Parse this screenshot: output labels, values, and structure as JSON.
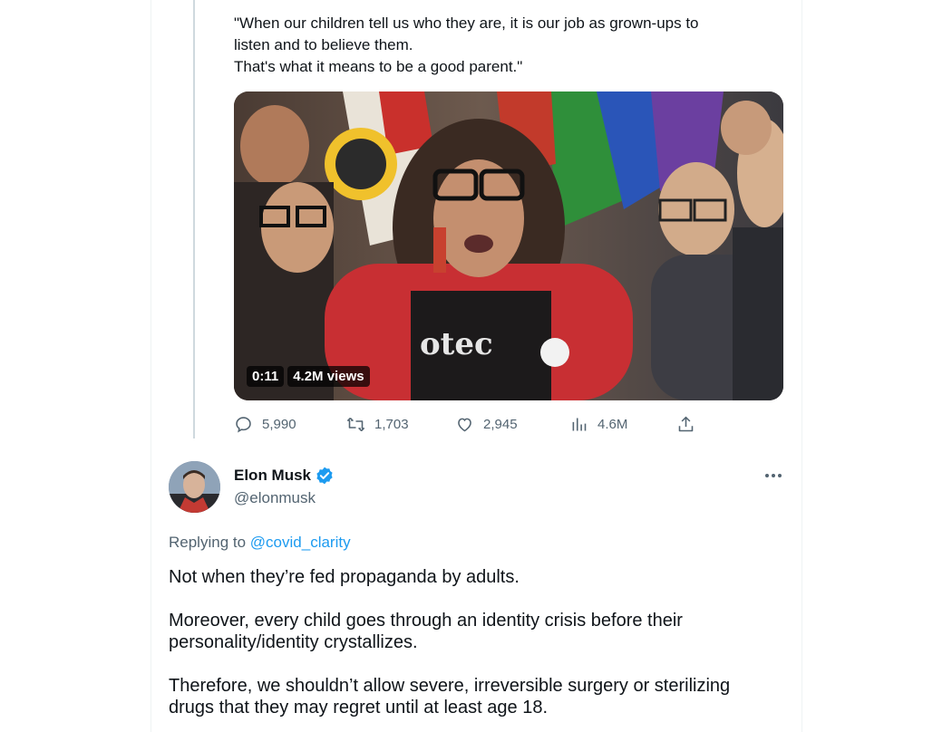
{
  "quoted_tweet": {
    "lines": [
      "\"When our children tell us who they are, it is our job as grown-ups to",
      "listen and to believe them.",
      "That's what it means to be a good parent.\""
    ],
    "video": {
      "duration": "0:11",
      "views": "4.2M views"
    },
    "actions": {
      "replies": "5,990",
      "reposts": "1,703",
      "likes": "2,945",
      "views": "4.6M"
    }
  },
  "reply": {
    "author_name": "Elon Musk",
    "author_handle": "@elonmusk",
    "replying_prefix": "Replying to",
    "replying_to": "@covid_clarity",
    "paragraphs": [
      [
        "Not when they’re fed propaganda by adults."
      ],
      [
        "Moreover, every child goes through an identity crisis before their",
        "personality/identity crystallizes."
      ],
      [
        "Therefore, we shouldn’t allow severe, irreversible surgery or sterilizing",
        "drugs that they may regret until at least age 18."
      ]
    ]
  },
  "colors": {
    "accent": "#1d9bf0",
    "muted_text": "#536471",
    "primary_text": "#0f1419",
    "thread_line": "#cfd9de"
  },
  "icons": [
    "reply-icon",
    "repost-icon",
    "like-icon",
    "views-icon",
    "share-icon",
    "verified-badge-icon",
    "more-icon"
  ]
}
